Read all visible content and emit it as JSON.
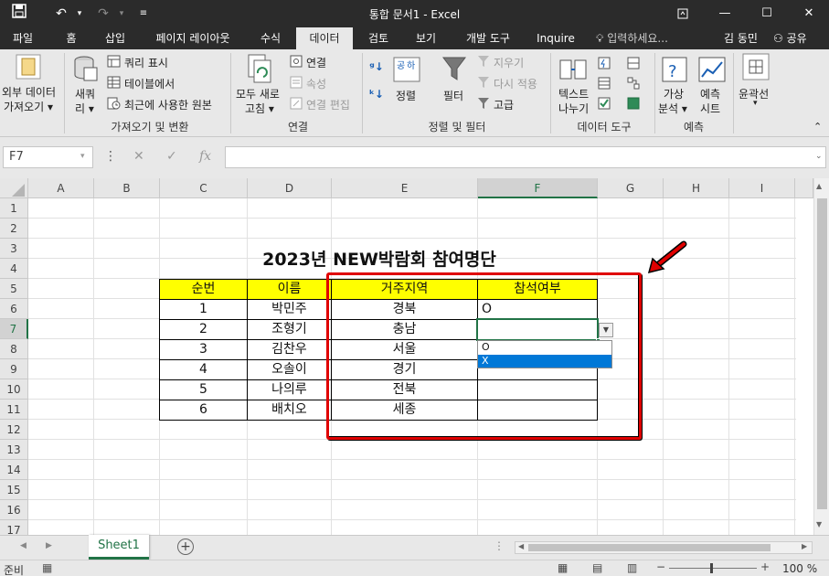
{
  "window": {
    "title": "통합 문서1 - Excel"
  },
  "tabs": [
    "파일",
    "홈",
    "삽입",
    "페이지 레이아웃",
    "수식",
    "데이터",
    "검토",
    "보기",
    "개발 도구",
    "Inquire"
  ],
  "tell_me": "입력하세요...",
  "user": "김 동민",
  "share": "공유",
  "ribbon": {
    "get_external": [
      "외부 데이터",
      "가져오기 ▾"
    ],
    "new_query": [
      "새쿼",
      "리 ▾"
    ],
    "show_query": "쿼리 표시",
    "from_table": "테이블에서",
    "recent_sources": "최근에 사용한 원본",
    "group_get_transform": "가져오기 및 변환",
    "refresh_all": [
      "모두 새로",
      "고침 ▾"
    ],
    "connections": "연결",
    "properties": "속성",
    "edit_links": "연결 편집",
    "group_connections": "연결",
    "sort": "정렬",
    "filter": "필터",
    "clear": "지우기",
    "reapply": "다시 적용",
    "advanced": "고급",
    "group_sort_filter": "정렬 및 필터",
    "text_to_columns": [
      "텍스트",
      "나누기"
    ],
    "group_data_tools": "데이터 도구",
    "what_if": [
      "가상",
      "분석 ▾"
    ],
    "forecast_sheet": [
      "예측",
      "시트"
    ],
    "group_forecast": "예측",
    "outline": "윤곽선"
  },
  "formula_bar": {
    "name_box": "F7",
    "fx": "fx",
    "value": ""
  },
  "columns": [
    "A",
    "B",
    "C",
    "D",
    "E",
    "F",
    "G",
    "H",
    "I"
  ],
  "selected_column": "F",
  "rows": [
    "1",
    "2",
    "3",
    "4",
    "5",
    "6",
    "7",
    "8",
    "9",
    "10",
    "11",
    "12",
    "13",
    "14",
    "15",
    "16",
    "17"
  ],
  "selected_row": "7",
  "sheet": {
    "title": "2023년 NEW박람회 참여명단",
    "headers": [
      "순번",
      "이름",
      "거주지역",
      "참석여부"
    ],
    "data": [
      [
        "1",
        "박민주",
        "경북",
        "O"
      ],
      [
        "2",
        "조형기",
        "충남",
        ""
      ],
      [
        "3",
        "김찬우",
        "서울",
        ""
      ],
      [
        "4",
        "오솔이",
        "경기",
        ""
      ],
      [
        "5",
        "나의루",
        "전북",
        ""
      ],
      [
        "6",
        "배치오",
        "세종",
        ""
      ]
    ],
    "dropdown_options": [
      "O",
      "X"
    ],
    "dropdown_highlighted": "X"
  },
  "sheet_tab": "Sheet1",
  "status": {
    "ready": "준비",
    "zoom": "100 %"
  },
  "colors": {
    "header_fill": "#ffff00",
    "highlight_box": "#e00000",
    "selection": "#217346",
    "dropdown_select": "#0078d7"
  }
}
